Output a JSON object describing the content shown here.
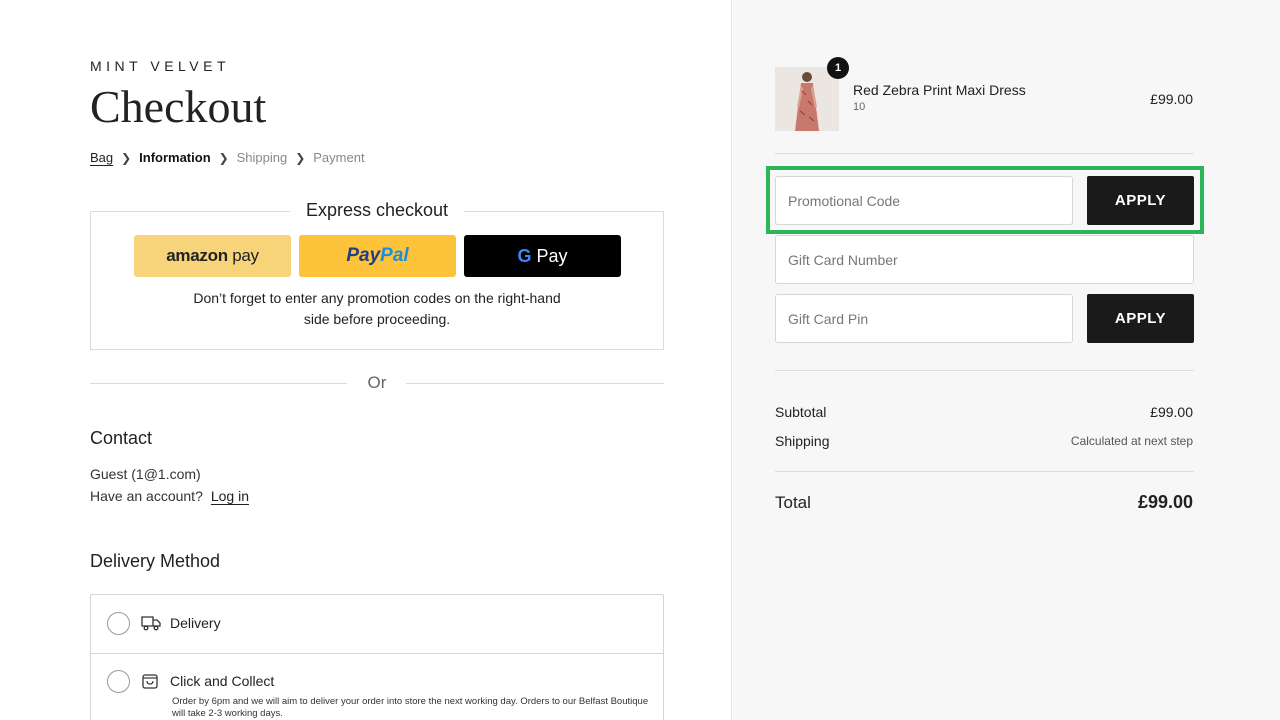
{
  "brand": "MINT VELVET",
  "page_title": "Checkout",
  "breadcrumbs": {
    "bag": "Bag",
    "information": "Information",
    "shipping": "Shipping",
    "payment": "Payment"
  },
  "express": {
    "title": "Express checkout",
    "amazon_label_1": "amazon",
    "amazon_label_2": " pay",
    "paypal_label_1": "Pay",
    "paypal_label_2": "Pal",
    "gpay_label_1": "G",
    "gpay_label_2": " Pay",
    "note": "Don’t forget to enter any promotion codes on the right-hand side before proceeding."
  },
  "divider_text": "Or",
  "contact": {
    "heading": "Contact",
    "guest": "Guest (1@1.com)",
    "account_prompt": "Have an account?",
    "login": "Log in"
  },
  "delivery_method": {
    "heading": "Delivery Method",
    "option_delivery": "Delivery",
    "option_collect": "Click and Collect",
    "collect_note": "Order by 6pm and we will aim to deliver your order into store the next working day. Orders to our Belfast Boutique will take 2-3 working days."
  },
  "order": {
    "quantity_badge": "1",
    "product_name": "Red Zebra Print Maxi Dress",
    "product_size": "10",
    "product_price": "£99.00"
  },
  "codes": {
    "promo_placeholder": "Promotional Code",
    "gift_number_placeholder": "Gift Card Number",
    "gift_pin_placeholder": "Gift Card Pin",
    "apply_label": "APPLY"
  },
  "summary": {
    "subtotal_label": "Subtotal",
    "subtotal_value": "£99.00",
    "shipping_label": "Shipping",
    "shipping_value": "Calculated at next step",
    "total_label": "Total",
    "total_value": "£99.00"
  },
  "colors": {
    "highlight": "#2db657",
    "button_dark": "#1a1a1a",
    "amazon_bg": "#f7d47a",
    "paypal_bg": "#fcc33b"
  }
}
